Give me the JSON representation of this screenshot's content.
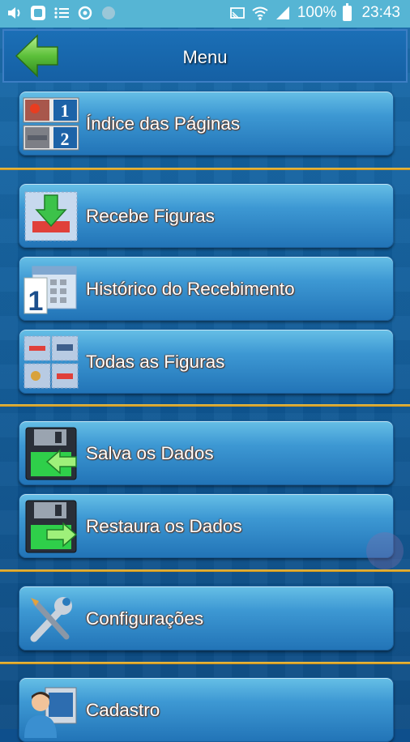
{
  "status_bar": {
    "battery": "100%",
    "time": "23:43"
  },
  "header": {
    "title": "Menu"
  },
  "menu": {
    "items": [
      {
        "label": "Índice das Páginas",
        "icon": "pages-index-icon",
        "page_numbers": [
          "1",
          "2"
        ]
      },
      {
        "label": "Recebe Figuras",
        "icon": "receive-figures-icon"
      },
      {
        "label": "Histórico do Recebimento",
        "icon": "calendar-icon",
        "calendar_day": "1"
      },
      {
        "label": "Todas as Figuras",
        "icon": "all-figures-icon"
      },
      {
        "label": "Salva os Dados",
        "icon": "save-data-icon"
      },
      {
        "label": "Restaura os Dados",
        "icon": "restore-data-icon"
      },
      {
        "label": "Configurações",
        "icon": "tools-icon"
      },
      {
        "label": "Cadastro",
        "icon": "user-register-icon"
      }
    ]
  },
  "colors": {
    "status_bar": "#56b5d4",
    "separator": "#e3aa2e",
    "button_top": "#66bfe6",
    "button_bottom": "#2274b7",
    "back_arrow": "#5cc03a"
  }
}
